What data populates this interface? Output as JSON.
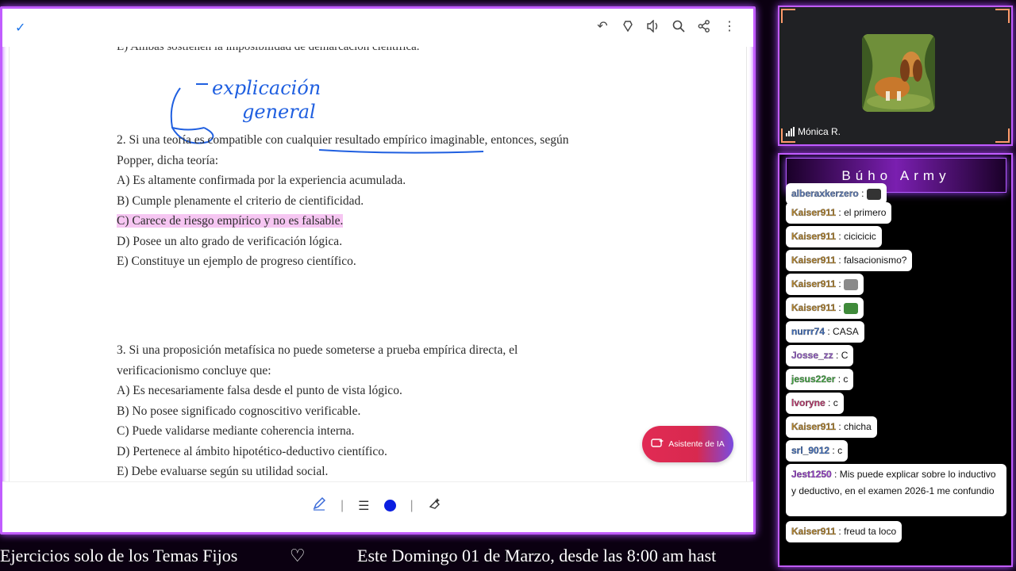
{
  "toolbar": {
    "check_icon": "check-icon",
    "icons": [
      "undo-icon",
      "read-aloud-icon",
      "volume-icon",
      "search-icon",
      "share-icon",
      "more-icon"
    ]
  },
  "document": {
    "cut_line": "E) Ambas sostienen la imposibilidad de demarcación científica.",
    "handwriting": "explicación general",
    "q2": {
      "stem_1": "2. Si una teoría es compatible con cualquier resultado empírico imaginable, entonces, según",
      "stem_2": "Popper, dicha teoría:",
      "a": "A) Es altamente confirmada por la experiencia acumulada.",
      "b": "B) Cumple plenamente el criterio de cientificidad.",
      "c": "C) Carece de riesgo empírico y no es falsable.",
      "d": "D) Posee un alto grado de verificación lógica.",
      "e": "E) Constituye un ejemplo de progreso científico."
    },
    "q3": {
      "stem_1": "3. Si una proposición metafísica no puede someterse a prueba empírica directa, el",
      "stem_2": "verificacionismo concluye que:",
      "a": "A) Es necesariamente falsa desde el punto de vista lógico.",
      "b": "B) No posee significado cognoscitivo verificable.",
      "c": "C) Puede validarse mediante coherencia interna.",
      "d": "D) Pertenece al ámbito hipotético-deductivo científico.",
      "e": "E) Debe evaluarse según su utilidad social."
    },
    "ai_button": "Asistente de IA",
    "highlight_color": "#f6c6f2"
  },
  "ticker": {
    "part1": "Ejercicios solo de los Temas Fijos",
    "heart": "♡",
    "part2": "Este Domingo 01 de Marzo, desde las 8:00 am hast"
  },
  "cam": {
    "name": "Mónica R."
  },
  "chat": {
    "title": "Búho Army",
    "messages": [
      {
        "user": "alberaxkerzero",
        "text": "",
        "color": "#5a7ab8",
        "emoji": "#333"
      },
      {
        "user": "Kaiser911",
        "text": "el primero",
        "color": "#b8862b"
      },
      {
        "user": "Kaiser911",
        "text": "cicicicic",
        "color": "#b8862b"
      },
      {
        "user": "Kaiser911",
        "text": "falsacionismo?",
        "color": "#b8862b"
      },
      {
        "user": "Kaiser911",
        "text": "",
        "color": "#b8862b",
        "emoji": "#8a8a8a"
      },
      {
        "user": "Kaiser911",
        "text": "",
        "color": "#b8862b",
        "emoji": "#3f8a3a"
      },
      {
        "user": "nurrr74",
        "text": "CASA",
        "color": "#3f6fc0"
      },
      {
        "user": "Josse_zz",
        "text": "C",
        "color": "#9a5fd0"
      },
      {
        "user": "jesus22er",
        "text": "c",
        "color": "#3fa83f"
      },
      {
        "user": "lvoryne",
        "text": "c",
        "color": "#c0396f"
      },
      {
        "user": "Kaiser911",
        "text": "chicha",
        "color": "#b8862b"
      },
      {
        "user": "srl_9012",
        "text": "c",
        "color": "#3f6fc0"
      },
      {
        "user": "Jest1250",
        "text": "Mis puede explicar sobre lo inductivo y deductivo, en el examen 2026-1 me confundio",
        "color": "#9a3fd0"
      },
      {
        "user": "Kaiser911",
        "text": "freud ta loco",
        "color": "#b8862b"
      }
    ]
  }
}
